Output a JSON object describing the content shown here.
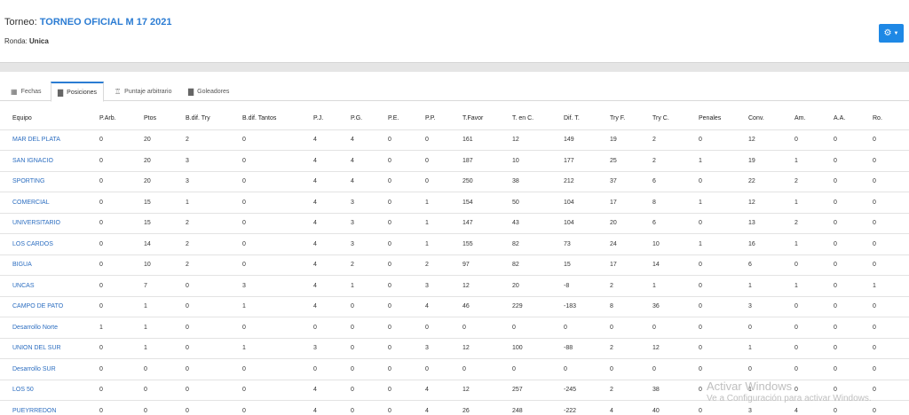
{
  "header": {
    "torneo_label": "Torneo: ",
    "torneo_name": "TORNEO OFICIAL M 17 2021",
    "ronda_label": "Ronda: ",
    "ronda_value": "Unica"
  },
  "tabs": [
    {
      "label": "Fechas",
      "icon": "calendar-icon",
      "active": false
    },
    {
      "label": "Posiciones",
      "icon": "bar-chart-icon",
      "active": true
    },
    {
      "label": "Puntaje arbitrario",
      "icon": "trophy-icon",
      "active": false
    },
    {
      "label": "Goleadores",
      "icon": "bar-chart-icon",
      "active": false
    }
  ],
  "table": {
    "headers": [
      "Equipo",
      "P.Arb.",
      "Ptos",
      "B.dif. Try",
      "B.dif. Tantos",
      "P.J.",
      "P.G.",
      "P.E.",
      "P.P.",
      "T.Favor",
      "T. en C.",
      "Dif. T.",
      "Try F.",
      "Try C.",
      "Penales",
      "Conv.",
      "Am.",
      "A.A.",
      "Ro."
    ],
    "rows": [
      [
        "MAR DEL PLATA",
        "0",
        "20",
        "2",
        "0",
        "4",
        "4",
        "0",
        "0",
        "161",
        "12",
        "149",
        "19",
        "2",
        "0",
        "12",
        "0",
        "0",
        "0"
      ],
      [
        "SAN IGNACIO",
        "0",
        "20",
        "3",
        "0",
        "4",
        "4",
        "0",
        "0",
        "187",
        "10",
        "177",
        "25",
        "2",
        "1",
        "19",
        "1",
        "0",
        "0"
      ],
      [
        "SPORTING",
        "0",
        "20",
        "3",
        "0",
        "4",
        "4",
        "0",
        "0",
        "250",
        "38",
        "212",
        "37",
        "6",
        "0",
        "22",
        "2",
        "0",
        "0"
      ],
      [
        "COMERCIAL",
        "0",
        "15",
        "1",
        "0",
        "4",
        "3",
        "0",
        "1",
        "154",
        "50",
        "104",
        "17",
        "8",
        "1",
        "12",
        "1",
        "0",
        "0"
      ],
      [
        "UNIVERSITARIO",
        "0",
        "15",
        "2",
        "0",
        "4",
        "3",
        "0",
        "1",
        "147",
        "43",
        "104",
        "20",
        "6",
        "0",
        "13",
        "2",
        "0",
        "0"
      ],
      [
        "LOS CARDOS",
        "0",
        "14",
        "2",
        "0",
        "4",
        "3",
        "0",
        "1",
        "155",
        "82",
        "73",
        "24",
        "10",
        "1",
        "16",
        "1",
        "0",
        "0"
      ],
      [
        "BIGUA",
        "0",
        "10",
        "2",
        "0",
        "4",
        "2",
        "0",
        "2",
        "97",
        "82",
        "15",
        "17",
        "14",
        "0",
        "6",
        "0",
        "0",
        "0"
      ],
      [
        "UNCAS",
        "0",
        "7",
        "0",
        "3",
        "4",
        "1",
        "0",
        "3",
        "12",
        "20",
        "-8",
        "2",
        "1",
        "0",
        "1",
        "1",
        "0",
        "1"
      ],
      [
        "CAMPO DE PATO",
        "0",
        "1",
        "0",
        "1",
        "4",
        "0",
        "0",
        "4",
        "46",
        "229",
        "-183",
        "8",
        "36",
        "0",
        "3",
        "0",
        "0",
        "0"
      ],
      [
        "Desarrollo Norte",
        "1",
        "1",
        "0",
        "0",
        "0",
        "0",
        "0",
        "0",
        "0",
        "0",
        "0",
        "0",
        "0",
        "0",
        "0",
        "0",
        "0",
        "0"
      ],
      [
        "UNION DEL SUR",
        "0",
        "1",
        "0",
        "1",
        "3",
        "0",
        "0",
        "3",
        "12",
        "100",
        "-88",
        "2",
        "12",
        "0",
        "1",
        "0",
        "0",
        "0"
      ],
      [
        "Desarrollo SUR",
        "0",
        "0",
        "0",
        "0",
        "0",
        "0",
        "0",
        "0",
        "0",
        "0",
        "0",
        "0",
        "0",
        "0",
        "0",
        "0",
        "0",
        "0"
      ],
      [
        "LOS 50",
        "0",
        "0",
        "0",
        "0",
        "4",
        "0",
        "0",
        "4",
        "12",
        "257",
        "-245",
        "2",
        "38",
        "0",
        "1",
        "0",
        "0",
        "0"
      ],
      [
        "PUEYRREDON",
        "0",
        "0",
        "0",
        "0",
        "4",
        "0",
        "0",
        "4",
        "26",
        "248",
        "-222",
        "4",
        "40",
        "0",
        "3",
        "4",
        "0",
        "0"
      ]
    ]
  },
  "watermark": {
    "line1": "Activar Windows",
    "line2": "Ve a Configuración para activar Windows."
  },
  "colors": {
    "accent": "#2b7cd3",
    "button": "#1e88e5"
  }
}
